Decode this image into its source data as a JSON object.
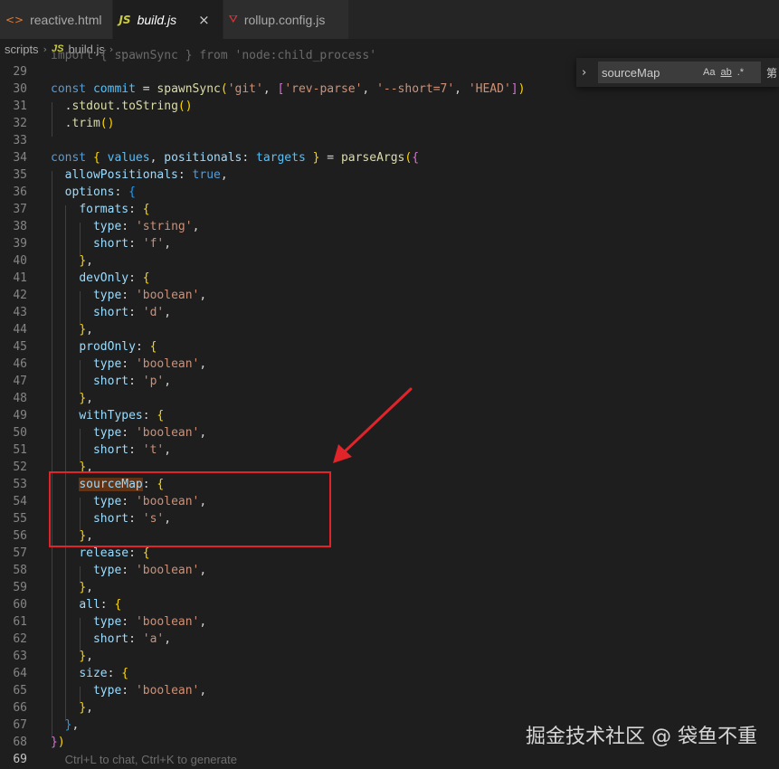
{
  "tabs": [
    {
      "icon": "html-file-icon",
      "label": "reactive.html",
      "active": false
    },
    {
      "icon": "js-file-icon",
      "label": "build.js",
      "active": true,
      "close": "×"
    },
    {
      "icon": "rollup-file-icon",
      "label": "rollup.config.js",
      "active": false
    }
  ],
  "icons": {
    "html": "<>",
    "js": "JS",
    "rollup": "⛛",
    "chevron": "›",
    "collapse": "›"
  },
  "breadcrumb": {
    "folder": "scripts",
    "file": "build.js",
    "more": "..."
  },
  "find": {
    "query": "sourceMap",
    "match_case": "Aa",
    "whole_word": "ab",
    "regex": ".*",
    "overflow": "第"
  },
  "editor": {
    "partial_top": "import { spawnSync } from 'node:child_process'",
    "line_numbers": [
      "29",
      "30",
      "31",
      "32",
      "33",
      "34",
      "35",
      "36",
      "37",
      "38",
      "39",
      "40",
      "41",
      "42",
      "43",
      "44",
      "45",
      "46",
      "47",
      "48",
      "49",
      "50",
      "51",
      "52",
      "53",
      "54",
      "55",
      "56",
      "57",
      "58",
      "59",
      "60",
      "61",
      "62",
      "63",
      "64",
      "65",
      "66",
      "67",
      "68",
      "69"
    ],
    "hint": "Ctrl+L to chat, Ctrl+K to generate"
  },
  "watermark": "掘金技术社区 @ 袋鱼不重",
  "colors": {
    "annotation": "#e0242a",
    "keyword": "#569cd6",
    "string": "#ce9178",
    "property": "#9cdcfe",
    "function": "#dcdcaa"
  }
}
